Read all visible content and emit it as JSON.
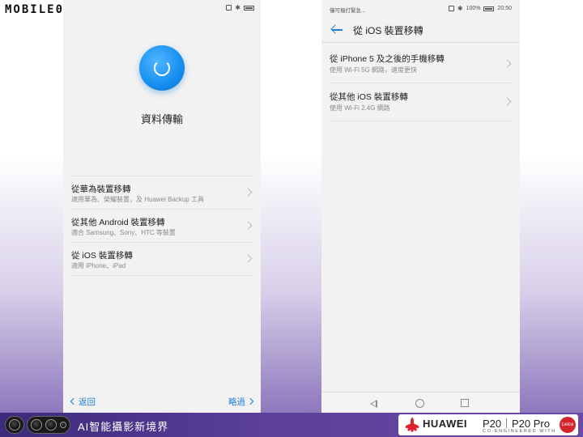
{
  "brand": {
    "logo_text": "MOBILE01"
  },
  "left_phone": {
    "title": "資料傳輸",
    "options": [
      {
        "title": "從華為裝置移轉",
        "subtitle": "適用華為、榮耀裝置，及 Huawei Backup 工具"
      },
      {
        "title": "從其他 Android 裝置移轉",
        "subtitle": "適合 Samsung、Sony、HTC 等裝置"
      },
      {
        "title": "從 iOS 裝置移轉",
        "subtitle": "適用 iPhone、iPad"
      }
    ],
    "back_label": "返回",
    "skip_label": "略過"
  },
  "right_phone": {
    "status_left": "僅可撥打緊急...",
    "status_battery": "100%",
    "status_time": "20:50",
    "title": "從 iOS 裝置移轉",
    "options": [
      {
        "title": "從 iPhone 5 及之後的手機移轉",
        "subtitle": "使用 Wi-Fi 5G 網路，速度更快"
      },
      {
        "title": "從其他 iOS 裝置移轉",
        "subtitle": "使用 Wi-Fi 2.4G 網路"
      }
    ]
  },
  "banner": {
    "text": "AI智能攝影新境界",
    "huawei": "HUAWEI",
    "model1": "P20",
    "model2": "P20 Pro",
    "tagline": "CO-ENGINEERED WITH",
    "leica": "Leica"
  },
  "colors": {
    "accent": "#1f7fe0",
    "banner": "#4b3490",
    "huawei_red": "#e0222c"
  }
}
